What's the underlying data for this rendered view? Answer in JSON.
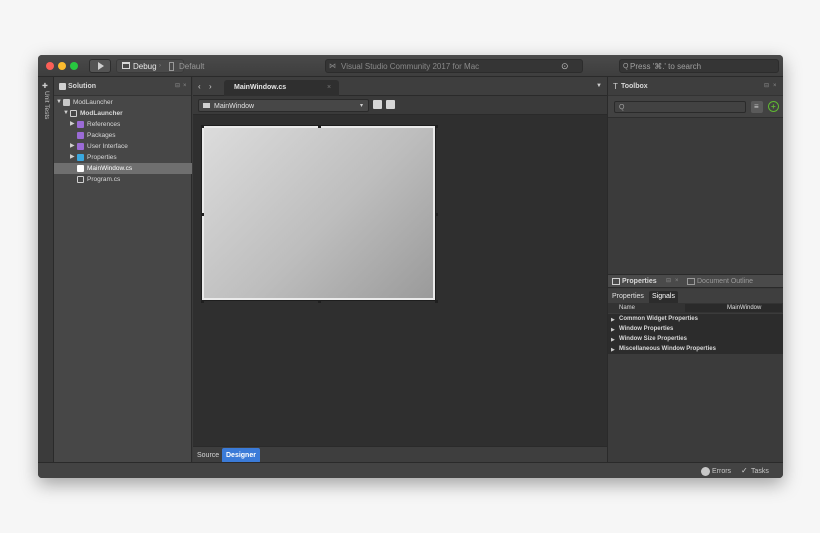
{
  "titlebar": {
    "config_label": "Debug",
    "target_label": "Default",
    "status_text": "Visual Studio Community 2017 for Mac",
    "search_placeholder": "Press '⌘.' to search"
  },
  "side_strip": {
    "unit_tests_label": "Unit Tests"
  },
  "solution": {
    "title": "Solution",
    "items": [
      {
        "label": "ModLauncher",
        "bold": false
      },
      {
        "label": "ModLauncher",
        "bold": true
      },
      {
        "label": "References"
      },
      {
        "label": "Packages"
      },
      {
        "label": "User Interface"
      },
      {
        "label": "Properties"
      },
      {
        "label": "MainWindow.cs",
        "selected": true
      },
      {
        "label": "Program.cs"
      }
    ]
  },
  "editor": {
    "active_tab": "MainWindow.cs",
    "combo_value": "MainWindow",
    "bottom_tabs": [
      "Source",
      "Designer"
    ],
    "active_bottom_tab": "Designer"
  },
  "toolbox": {
    "title": "Toolbox"
  },
  "properties": {
    "title": "Properties",
    "document_outline_title": "Document Outline",
    "tabs": [
      "Properties",
      "Signals"
    ],
    "name_label": "Name",
    "name_value": "MainWindow",
    "sections": [
      "Common Widget Properties",
      "Window Properties",
      "Window Size Properties",
      "Miscellaneous Window Properties"
    ]
  },
  "statusbar": {
    "errors_label": "Errors",
    "tasks_label": "Tasks"
  },
  "colors": {
    "accent": "#3b7bd8",
    "close": "#fc5f57",
    "minimize": "#fdbc2e",
    "zoom": "#28c840",
    "add_green": "#5fb832"
  }
}
